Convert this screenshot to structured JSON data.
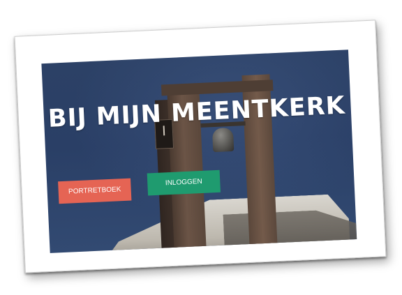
{
  "hero": {
    "headline": "BIJ MIJN MEENTKERK",
    "buttons": {
      "portretboek_label": "PORTRETBOEK",
      "inloggen_label": "INLOGGEN"
    }
  },
  "colors": {
    "portretboek_button": "#e56454",
    "inloggen_button": "#1f9b6f",
    "sky": "#2c4166"
  },
  "icons": {
    "clock": "clock-icon",
    "bell": "bell-icon"
  }
}
